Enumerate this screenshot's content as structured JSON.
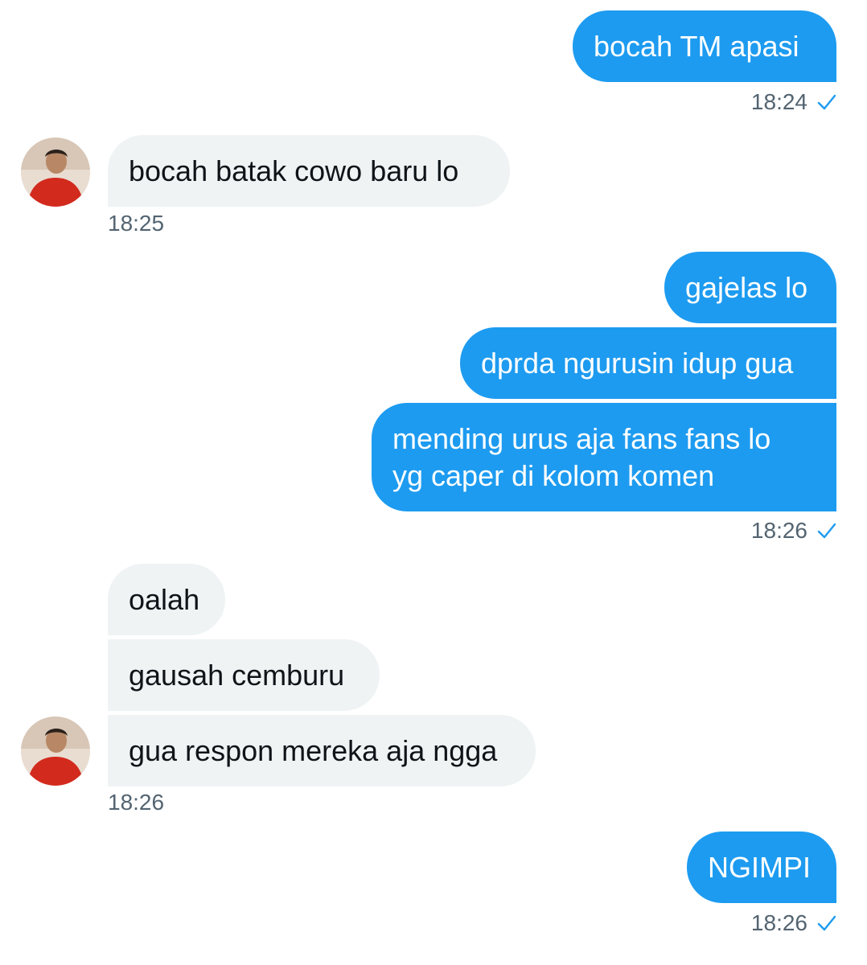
{
  "messages": {
    "m1": "bocah TM apasi",
    "m2": "bocah batak cowo baru lo",
    "m3": "gajelas lo",
    "m4": "dprda ngurusin idup gua",
    "m5_line1": "mending urus aja fans fans lo",
    "m5_line2": "yg caper di kolom komen",
    "m6": "oalah",
    "m7": "gausah cemburu",
    "m8": "gua respon mereka aja ngga",
    "m9": "NGIMPI"
  },
  "timestamps": {
    "t1": "18:24",
    "t2": "18:25",
    "t3": "18:26",
    "t4": "18:26",
    "t5": "18:26"
  },
  "colors": {
    "outgoing_bubble": "#1d9bf0",
    "incoming_bubble": "#eff3f4",
    "timestamp_text": "#536471",
    "read_check": "#1d9bf0"
  },
  "icons": {
    "read_receipt": "check-icon",
    "contact_avatar": "avatar"
  }
}
